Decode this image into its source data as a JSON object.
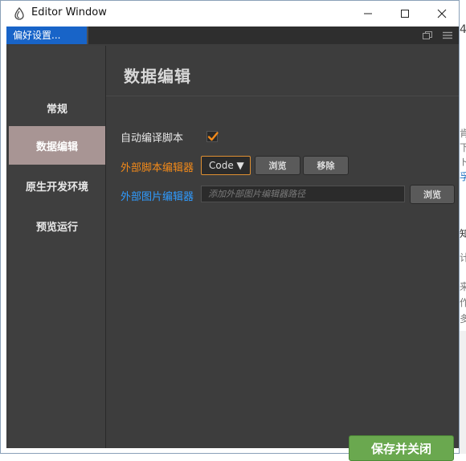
{
  "window": {
    "title": "Editor Window",
    "controls": {
      "minimize": "minimize",
      "maximize": "maximize",
      "close": "close"
    }
  },
  "tabs": [
    {
      "label": "偏好设置..."
    }
  ],
  "sidebar": {
    "items": [
      {
        "label": "常规",
        "active": false
      },
      {
        "label": "数据编辑",
        "active": true
      },
      {
        "label": "原生开发环境",
        "active": false
      },
      {
        "label": "预览运行",
        "active": false
      }
    ]
  },
  "main": {
    "title": "数据编辑",
    "auto_compile": {
      "label": "自动编译脚本",
      "checked": true
    },
    "script_editor": {
      "label": "外部脚本编辑器",
      "selected": "Code ▼",
      "browse_label": "浏览",
      "remove_label": "移除"
    },
    "image_editor": {
      "label": "外部图片编辑器",
      "placeholder": "添加外部图片编辑器路径",
      "browse_label": "浏览"
    },
    "save_label": "保存并关闭"
  },
  "background_glyphs": [
    "4",
    "肯",
    "下",
    "ト",
    "孚",
    "知",
    "计",
    "来",
    "作",
    "多"
  ],
  "colors": {
    "accent_tab": "#1864c8",
    "sidebar_active": "#a89594",
    "label_orange": "#f28a1a",
    "label_blue": "#2f9bff",
    "save_green": "#6aa84f",
    "checkmark": "#f28a1a",
    "panel_bg": "#3d3d3d"
  }
}
